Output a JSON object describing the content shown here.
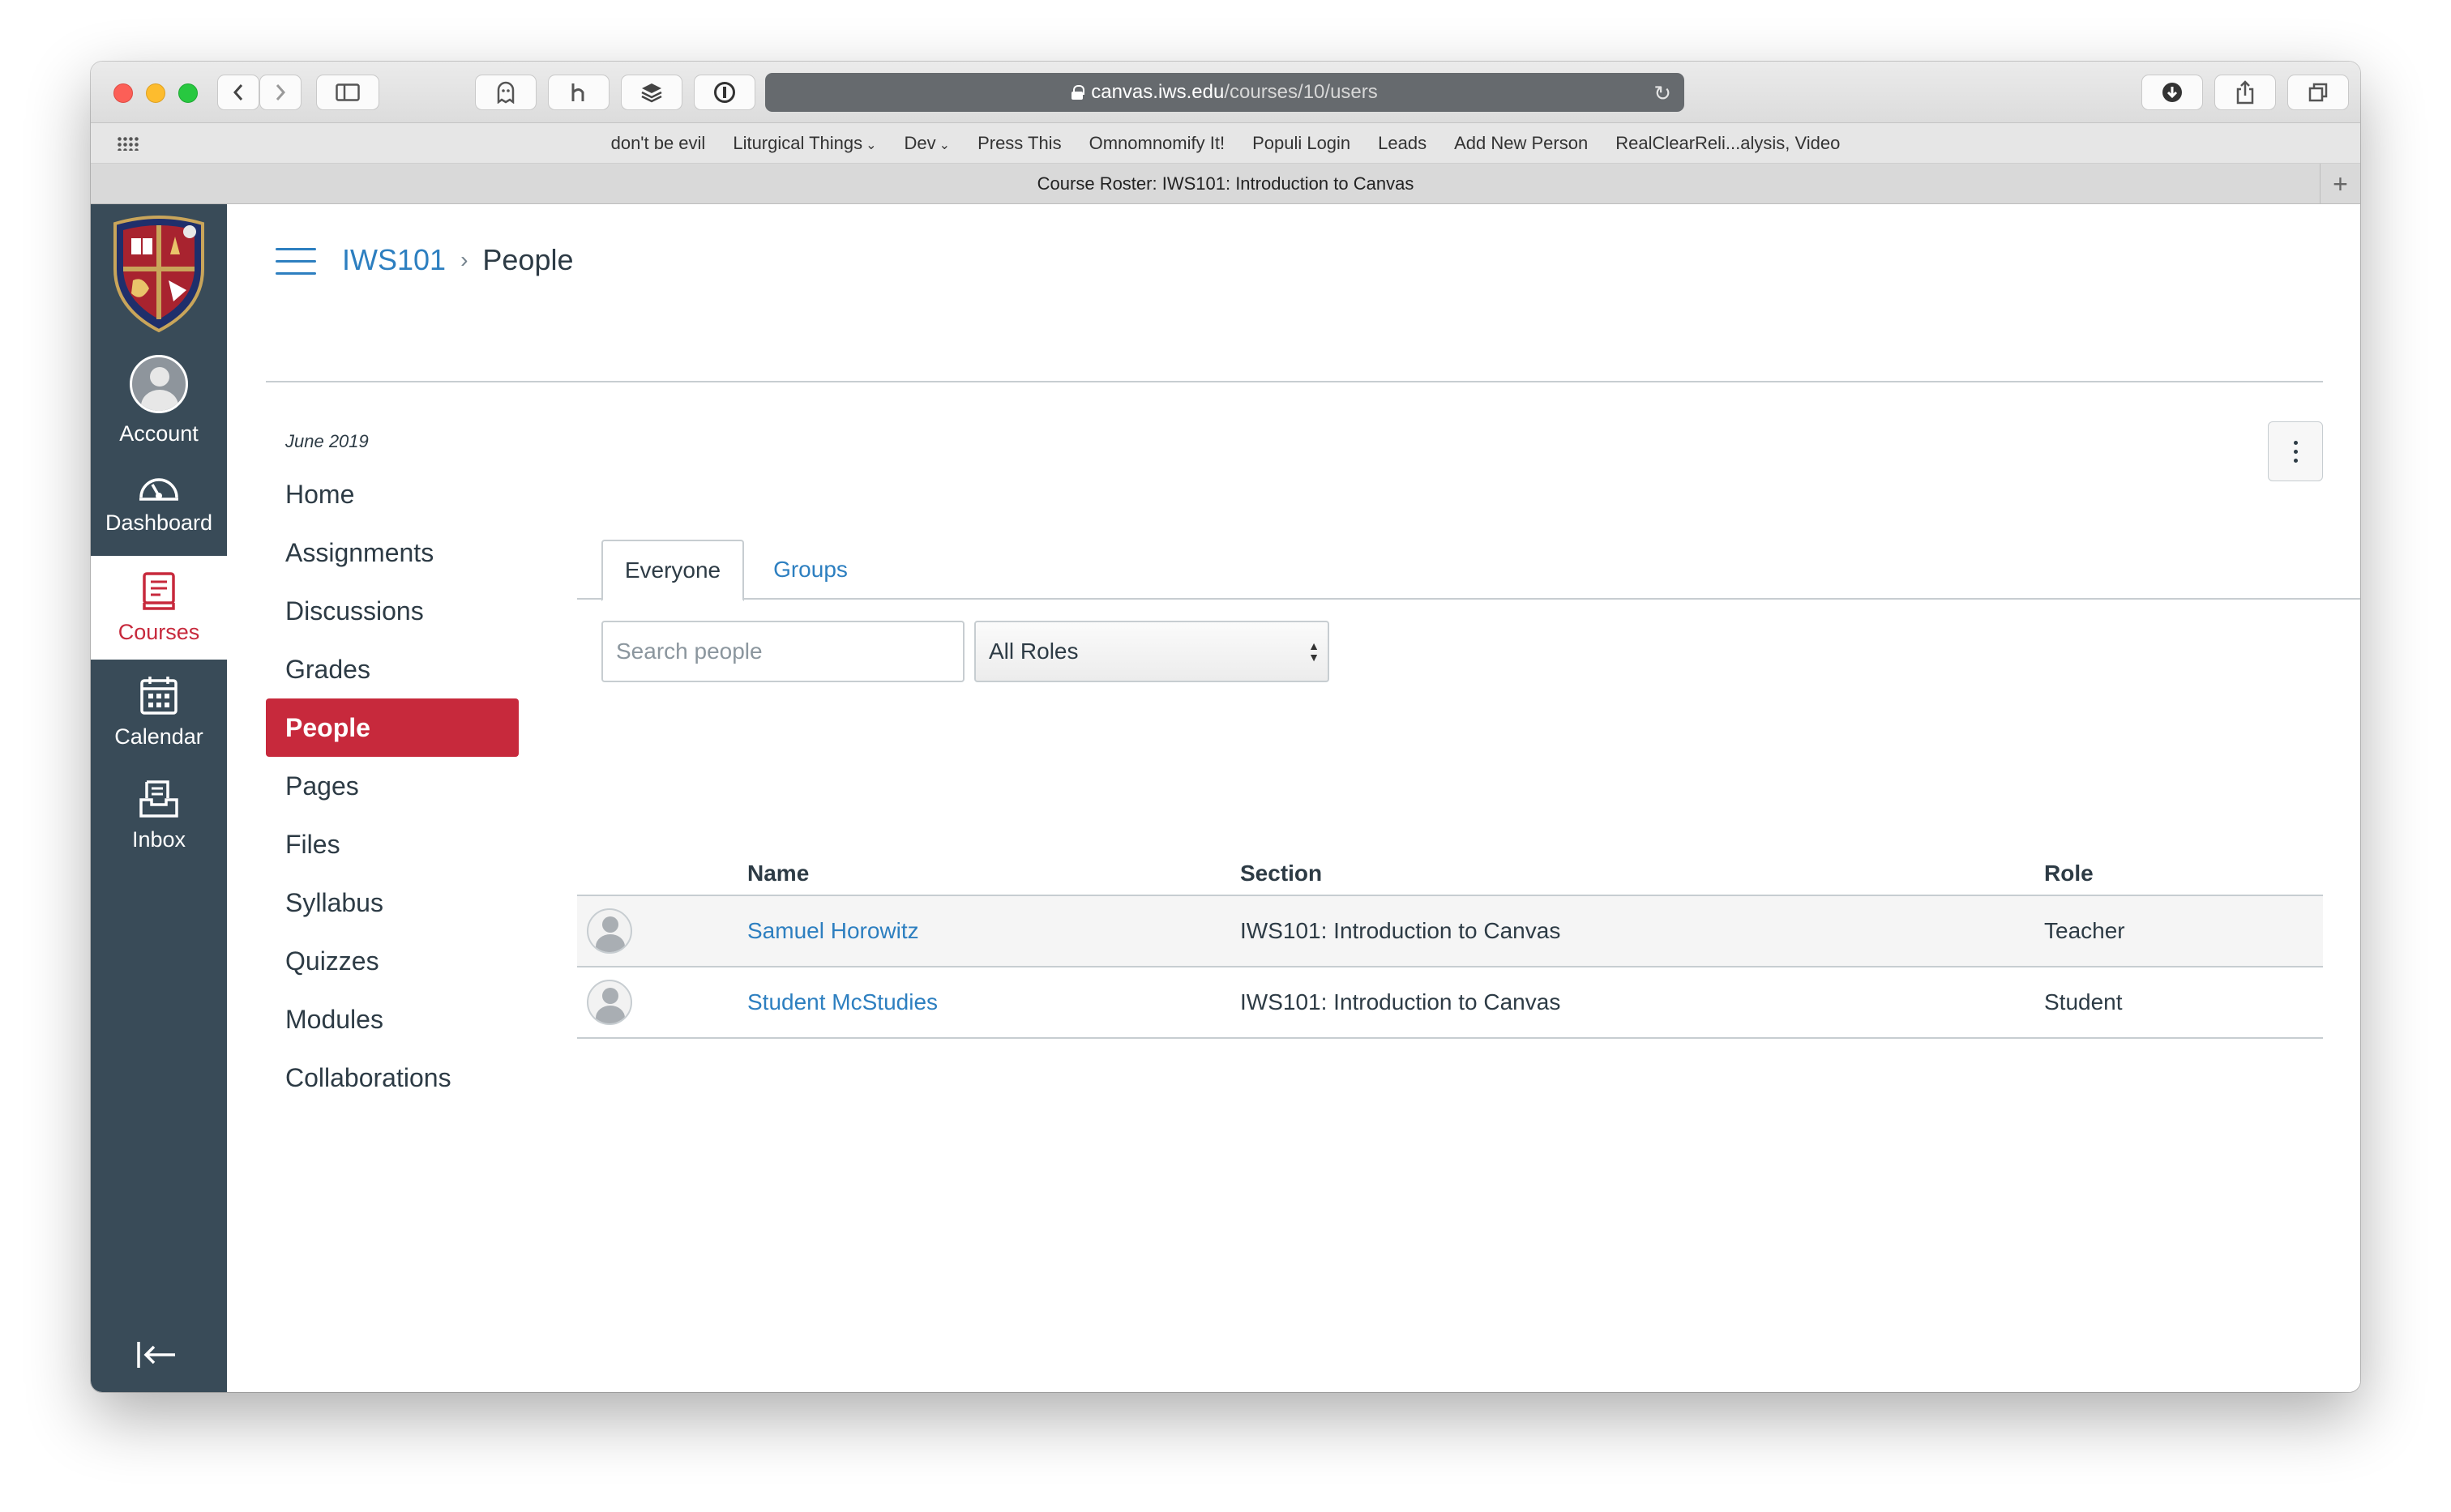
{
  "browser": {
    "url_host": "canvas.iws.edu",
    "url_path": "/courses/10/users",
    "tab_title": "Course Roster: IWS101: Introduction to Canvas",
    "bookmarks": [
      {
        "label": "don't be evil",
        "dropdown": false
      },
      {
        "label": "Liturgical Things",
        "dropdown": true
      },
      {
        "label": "Dev",
        "dropdown": true
      },
      {
        "label": "Press This",
        "dropdown": false
      },
      {
        "label": "Omnomnomify It!",
        "dropdown": false
      },
      {
        "label": "Populi Login",
        "dropdown": false
      },
      {
        "label": "Leads",
        "dropdown": false
      },
      {
        "label": "Add New Person",
        "dropdown": false
      },
      {
        "label": "RealClearReli...alysis, Video",
        "dropdown": false
      }
    ]
  },
  "global_nav": {
    "account": "Account",
    "dashboard": "Dashboard",
    "courses": "Courses",
    "calendar": "Calendar",
    "inbox": "Inbox"
  },
  "breadcrumb": {
    "course": "IWS101",
    "page": "People"
  },
  "course_nav": {
    "term": "June 2019",
    "items": [
      "Home",
      "Assignments",
      "Discussions",
      "Grades",
      "People",
      "Pages",
      "Files",
      "Syllabus",
      "Quizzes",
      "Modules",
      "Collaborations"
    ],
    "active": "People"
  },
  "tabs": {
    "everyone": "Everyone",
    "groups": "Groups"
  },
  "filters": {
    "search_placeholder": "Search people",
    "role_selected": "All Roles"
  },
  "roster": {
    "headers": {
      "name": "Name",
      "section": "Section",
      "role": "Role"
    },
    "rows": [
      {
        "name": "Samuel Horowitz",
        "section": "IWS101: Introduction to Canvas",
        "role": "Teacher"
      },
      {
        "name": "Student McStudies",
        "section": "IWS101: Introduction to Canvas",
        "role": "Student"
      }
    ]
  },
  "colors": {
    "nav_bg": "#394b58",
    "brand_red": "#c7293c",
    "link_blue": "#2d7fc0"
  }
}
